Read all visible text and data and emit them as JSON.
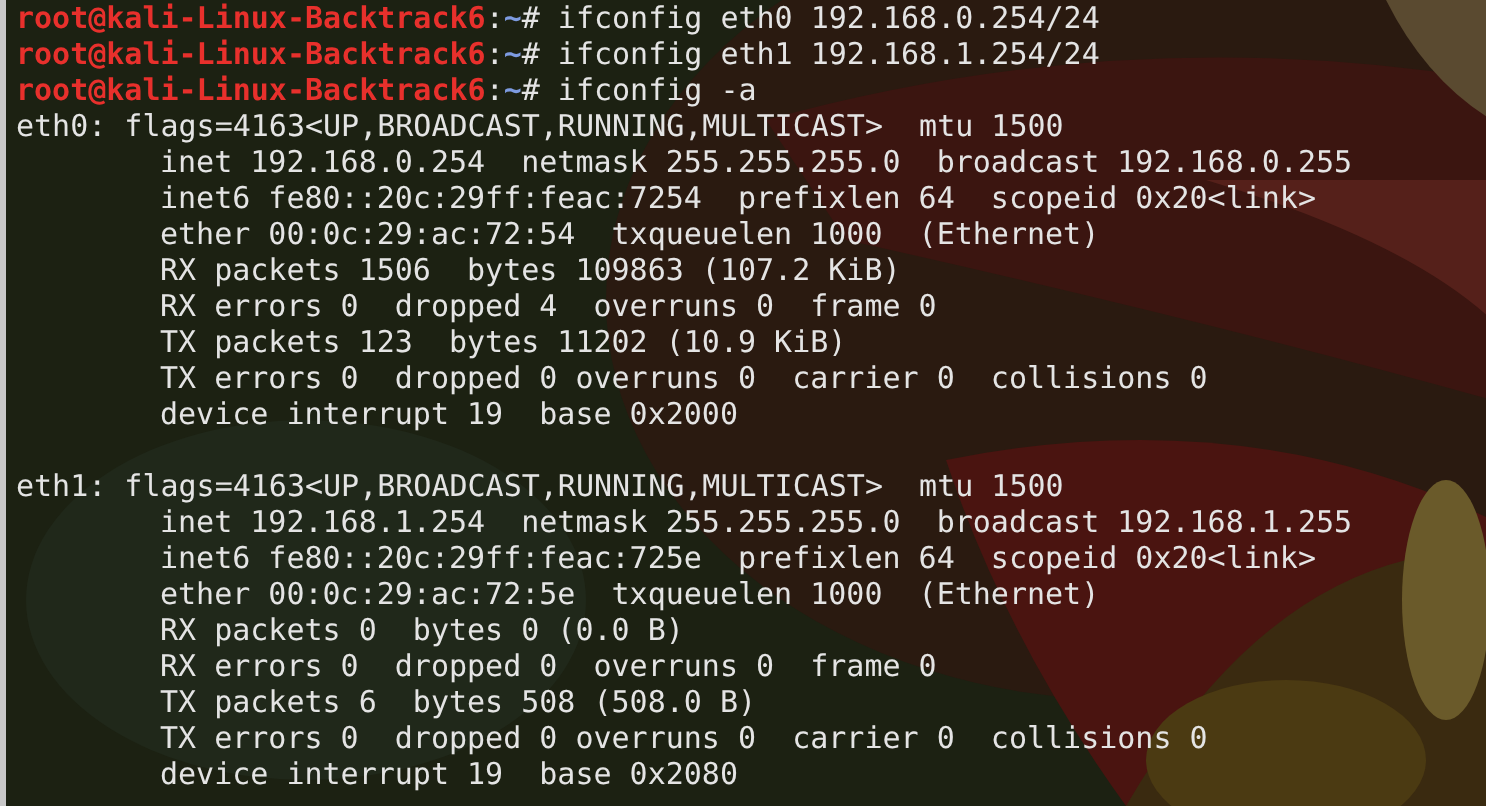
{
  "terminal": {
    "prompts": [
      {
        "user_host": "root@kali-Linux-Backtrack6",
        "separator": ":",
        "path": "~",
        "symbol": "#",
        "command": " ifconfig eth0 192.168.0.254/24"
      },
      {
        "user_host": "root@kali-Linux-Backtrack6",
        "separator": ":",
        "path": "~",
        "symbol": "#",
        "command": " ifconfig eth1 192.168.1.254/24"
      },
      {
        "user_host": "root@kali-Linux-Backtrack6",
        "separator": ":",
        "path": "~",
        "symbol": "#",
        "command": " ifconfig -a"
      }
    ],
    "interfaces": [
      {
        "header": "eth0: flags=4163<UP,BROADCAST,RUNNING,MULTICAST>  mtu 1500",
        "details": [
          "inet 192.168.0.254  netmask 255.255.255.0  broadcast 192.168.0.255",
          "inet6 fe80::20c:29ff:feac:7254  prefixlen 64  scopeid 0x20<link>",
          "ether 00:0c:29:ac:72:54  txqueuelen 1000  (Ethernet)",
          "RX packets 1506  bytes 109863 (107.2 KiB)",
          "RX errors 0  dropped 4  overruns 0  frame 0",
          "TX packets 123  bytes 11202 (10.9 KiB)",
          "TX errors 0  dropped 0 overruns 0  carrier 0  collisions 0",
          "device interrupt 19  base 0x2000"
        ]
      },
      {
        "header": "eth1: flags=4163<UP,BROADCAST,RUNNING,MULTICAST>  mtu 1500",
        "details": [
          "inet 192.168.1.254  netmask 255.255.255.0  broadcast 192.168.1.255",
          "inet6 fe80::20c:29ff:feac:725e  prefixlen 64  scopeid 0x20<link>",
          "ether 00:0c:29:ac:72:5e  txqueuelen 1000  (Ethernet)",
          "RX packets 0  bytes 0 (0.0 B)",
          "RX errors 0  dropped 0  overruns 0  frame 0",
          "TX packets 6  bytes 508 (508.0 B)",
          "TX errors 0  dropped 0 overruns 0  carrier 0  collisions 0",
          "device interrupt 19  base 0x2080"
        ]
      }
    ]
  }
}
